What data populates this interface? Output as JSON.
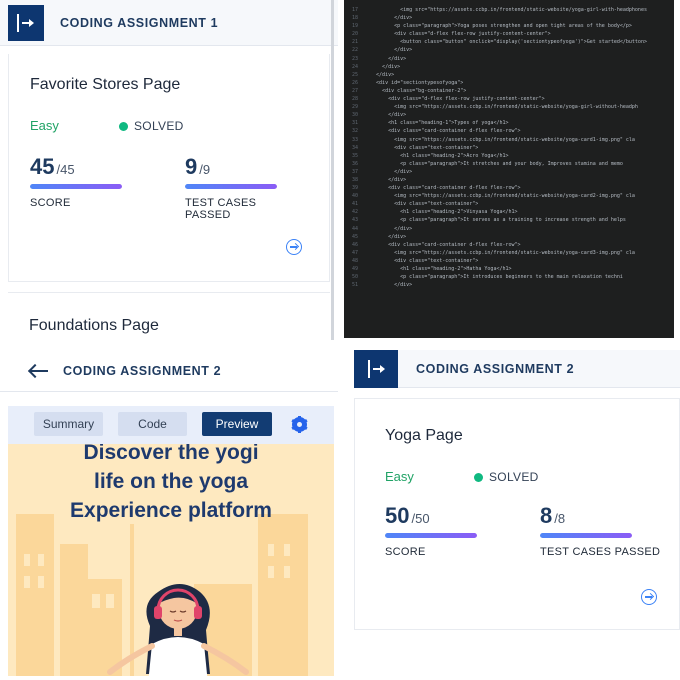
{
  "panel_tl": {
    "assignment_title": "CODING ASSIGNMENT 1",
    "problem": {
      "title": "Favorite Stores Page",
      "difficulty": "Easy",
      "status": "SOLVED",
      "score": {
        "value": "45",
        "total": "/45",
        "label": "SCORE",
        "fraction": 1.0
      },
      "tests": {
        "value": "9",
        "total": "/9",
        "label": "TEST CASES PASSED",
        "fraction": 1.0
      }
    },
    "next_problem_title": "Foundations Page"
  },
  "panel_tr": {
    "code_lines": [
      {
        "n": "17",
        "text": "            <img src=\"https://assets.ccbp.in/frontend/static-website/yoga-girl-with-headphones"
      },
      {
        "n": "18",
        "text": "          </div>"
      },
      {
        "n": "19",
        "text": "          <p class=\"paragraph\">Yoga poses strengthen and open tight areas of the body</p>"
      },
      {
        "n": "20",
        "text": "          <div class=\"d-flex flex-row justify-content-center\">"
      },
      {
        "n": "21",
        "text": "            <button class=\"button\" onclick=\"display('sectiontypeofyoga')\">Get started</button>"
      },
      {
        "n": "22",
        "text": "          </div>"
      },
      {
        "n": "23",
        "text": "        </div>"
      },
      {
        "n": "24",
        "text": "      </div>"
      },
      {
        "n": "25",
        "text": "    </div>"
      },
      {
        "n": "26",
        "text": "    <div id=\"sectiontypesofyoga\">"
      },
      {
        "n": "27",
        "text": "      <div class=\"bg-container-2\">"
      },
      {
        "n": "28",
        "text": "        <div class=\"d-flex flex-row justify-content-center\">"
      },
      {
        "n": "29",
        "text": "          <img src=\"https://assets.ccbp.in/frontend/static-website/yoga-girl-without-headph"
      },
      {
        "n": "30",
        "text": "        </div>"
      },
      {
        "n": "31",
        "text": "        <h1 class=\"heading-1\">Types of yoga</h1>"
      },
      {
        "n": "32",
        "text": "        <div class=\"card-container d-flex flex-row\">"
      },
      {
        "n": "33",
        "text": "          <img src=\"https://assets.ccbp.in/frontend/static-website/yoga-card1-img.png\" cla"
      },
      {
        "n": "34",
        "text": "          <div class=\"text-container\">"
      },
      {
        "n": "35",
        "text": "            <h1 class=\"heading-2\">Acro Yoga</h1>"
      },
      {
        "n": "36",
        "text": "            <p class=\"paragraph\">It stretches and your body, Improves stamina and memo"
      },
      {
        "n": "37",
        "text": "          </div>"
      },
      {
        "n": "38",
        "text": "        </div>"
      },
      {
        "n": "39",
        "text": "        <div class=\"card-container d-flex flex-row\">"
      },
      {
        "n": "40",
        "text": "          <img src=\"https://assets.ccbp.in/frontend/static-website/yoga-card2-img.png\" cla"
      },
      {
        "n": "41",
        "text": "          <div class=\"text-container\">"
      },
      {
        "n": "42",
        "text": "            <h1 class=\"heading-2\">Vinyasa Yoga</h1>"
      },
      {
        "n": "43",
        "text": "            <p class=\"paragraph\">It serves as a training to increase strength and helps"
      },
      {
        "n": "44",
        "text": "          </div>"
      },
      {
        "n": "45",
        "text": "        </div>"
      },
      {
        "n": "46",
        "text": "        <div class=\"card-container d-flex flex-row\">"
      },
      {
        "n": "47",
        "text": "          <img src=\"https://assets.ccbp.in/frontend/static-website/yoga-card3-img.png\" cla"
      },
      {
        "n": "48",
        "text": "          <div class=\"text-container\">"
      },
      {
        "n": "49",
        "text": "            <h1 class=\"heading-2\">Hatha Yoga</h1>"
      },
      {
        "n": "50",
        "text": "            <p class=\"paragraph\">It introduces beginners to the main relaxation techni"
      },
      {
        "n": "51",
        "text": "          </div>"
      }
    ]
  },
  "panel_bl": {
    "assignment_title": "CODING ASSIGNMENT 2",
    "tabs": {
      "summary": "Summary",
      "code": "Code",
      "preview": "Preview"
    },
    "hero_lines": [
      "Discover the yogi",
      "life on the yoga",
      "Experience platform"
    ]
  },
  "panel_br": {
    "assignment_title": "CODING ASSIGNMENT 2",
    "problem": {
      "title": "Yoga Page",
      "difficulty": "Easy",
      "status": "SOLVED",
      "score": {
        "value": "50",
        "total": "/50",
        "label": "SCORE",
        "fraction": 1.0
      },
      "tests": {
        "value": "8",
        "total": "/8",
        "label": "TEST CASES PASSED",
        "fraction": 1.0
      }
    }
  },
  "colors": {
    "brand_navy": "#0d3670",
    "easy_green": "#21a366",
    "solved_dot": "#10b981",
    "progress_start": "#4f86f7",
    "progress_end": "#8b5cf6",
    "preview_bg": "#fee9c0",
    "editor_bg": "#1e1f1f"
  },
  "icons": [
    "logo-icon",
    "arrow-right-circle-icon",
    "back-arrow-icon",
    "gear-icon",
    "solved-dot-icon"
  ]
}
